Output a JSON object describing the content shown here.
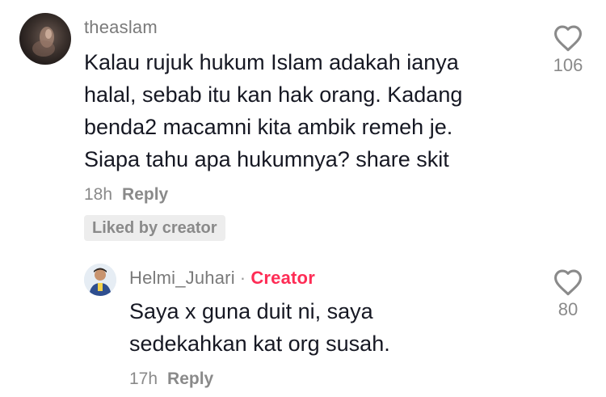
{
  "comments": [
    {
      "username": "theaslam",
      "text": "Kalau rujuk hukum Islam adakah ianya\nhalal, sebab itu kan hak orang. Kadang\nbenda2 macamni kita ambik remeh je.\nSiapa tahu apa hukumnya? share skit",
      "time": "18h",
      "reply_label": "Reply",
      "liked_by_label": "Liked by creator",
      "likes": "106"
    }
  ],
  "replies": [
    {
      "username": "Helmi_Juhari",
      "separator": "·",
      "badge": "Creator",
      "text": "Saya x guna duit ni, saya\nsedekahkan kat org susah.",
      "time": "17h",
      "reply_label": "Reply",
      "likes": "80"
    }
  ],
  "colors": {
    "creator_badge": "#fe2c55",
    "muted_text": "#8a8a8a",
    "body_text": "#161823"
  },
  "icons": {
    "like": "heart-outline-icon"
  }
}
